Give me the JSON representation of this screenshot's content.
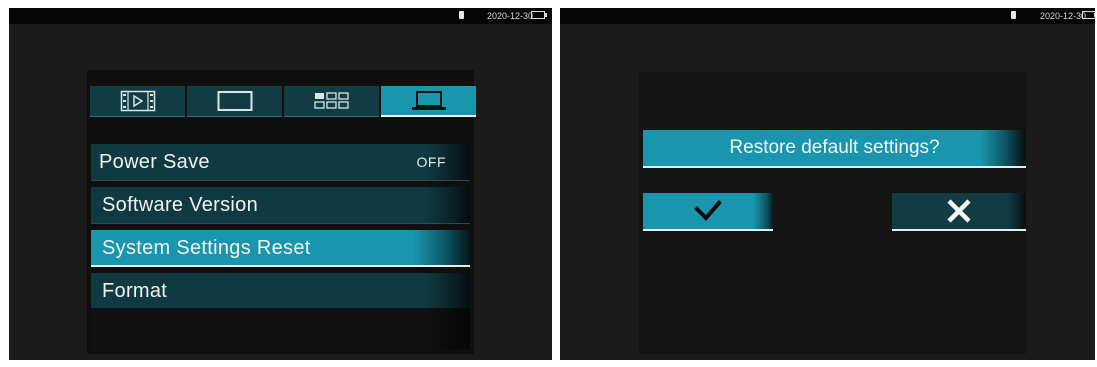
{
  "status": {
    "date": "2020-12-30",
    "battery_level": 1.0,
    "battery_color": "#3fcf3f"
  },
  "settings_menu": {
    "tabs": [
      {
        "icon": "film-play-icon",
        "active": false
      },
      {
        "icon": "screen-rectangle-icon",
        "active": false
      },
      {
        "icon": "grid-icon",
        "active": false
      },
      {
        "icon": "laptop-icon",
        "active": true
      }
    ],
    "items": [
      {
        "label": "Power Save",
        "value": "OFF"
      },
      {
        "label": "Software Version"
      },
      {
        "label": "System Settings Reset",
        "selected": true
      },
      {
        "label": "Format"
      }
    ]
  },
  "reset_dialog": {
    "question": "Restore default settings?",
    "confirm_icon": "checkmark-icon",
    "cancel_icon": "cross-icon"
  },
  "colors": {
    "accent": "#1995ad",
    "item_background": "#0f3a41",
    "screen_background": "#1b1b1b"
  }
}
